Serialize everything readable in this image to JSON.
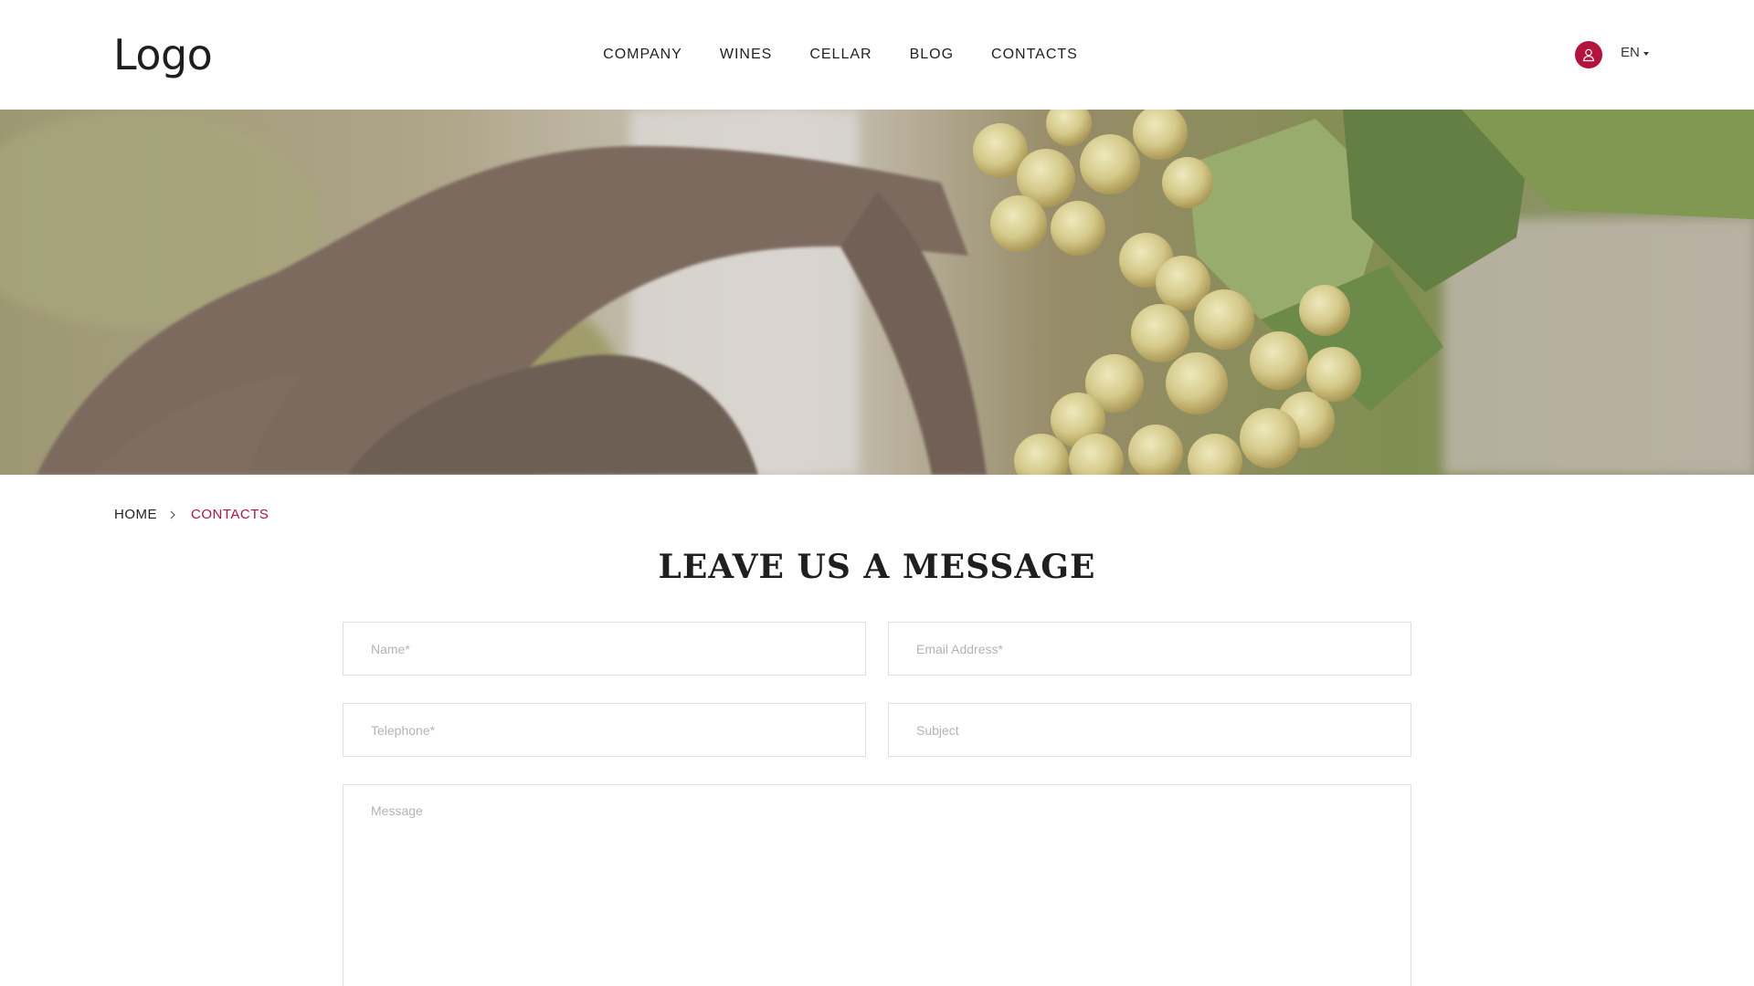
{
  "header": {
    "logo": "Logo",
    "nav": [
      "COMPANY",
      "WINES",
      "CELLAR",
      "BLOG",
      "CONTACTS"
    ],
    "language": "EN",
    "user_icon": "user-icon"
  },
  "hero": {
    "image": "grapes-on-vine-photo"
  },
  "breadcrumb": {
    "home": "HOME",
    "current": "CONTACTS"
  },
  "contact": {
    "title": "LEAVE US A MESSAGE",
    "name_placeholder": "Name*",
    "email_placeholder": "Email Address*",
    "phone_placeholder": "Telephone*",
    "subject_placeholder": "Subject",
    "message_placeholder": "Message"
  },
  "colors": {
    "accent": "#b5123e",
    "text": "#1f1f1f",
    "border": "#dedede",
    "placeholder": "#b3b3b3"
  }
}
